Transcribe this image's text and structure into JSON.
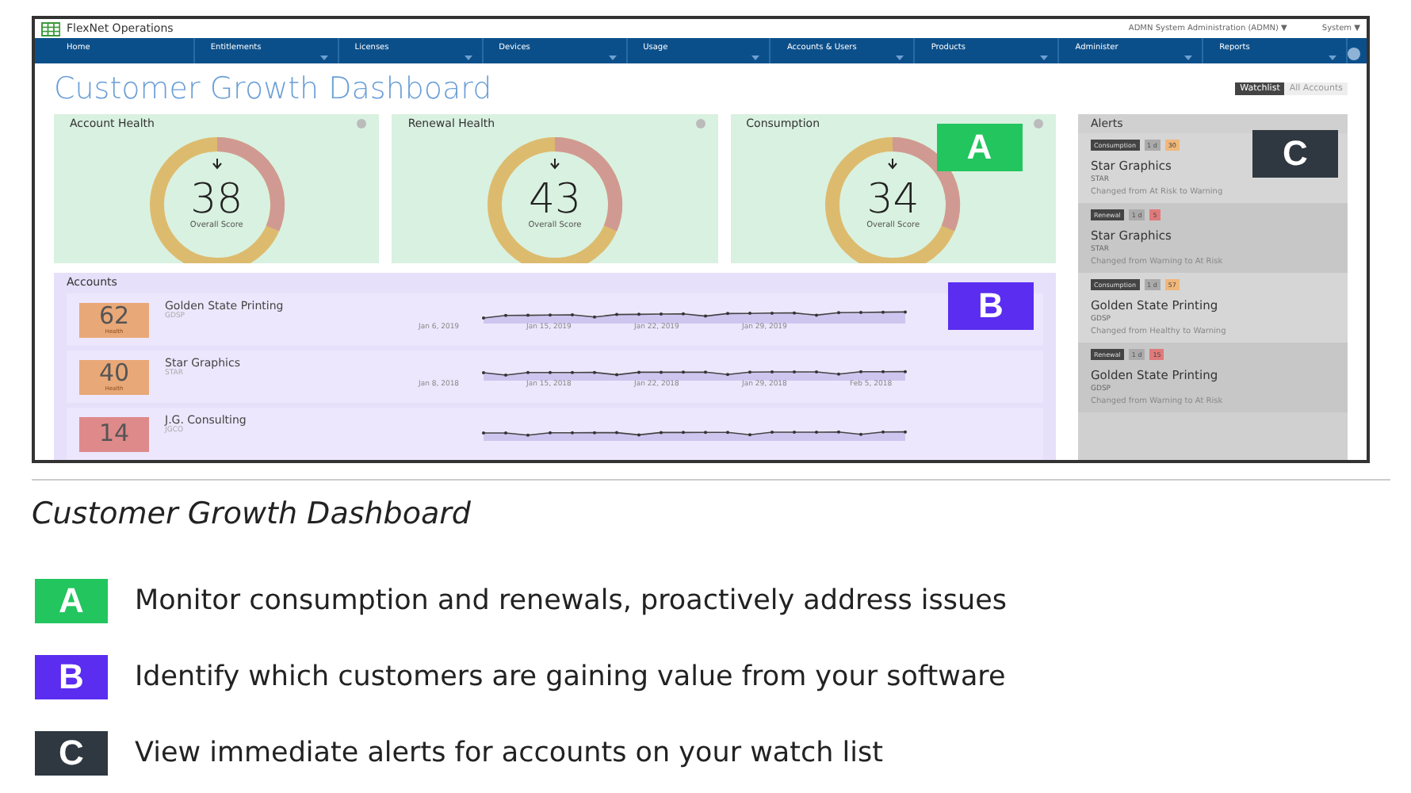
{
  "app": {
    "name": "FlexNet Operations",
    "user_menu": "ADMN System Administration (ADMN) ▼",
    "system_menu": "System ▼"
  },
  "nav": [
    {
      "label": "Home",
      "dropdown": false
    },
    {
      "label": "Entitlements",
      "dropdown": true
    },
    {
      "label": "Licenses",
      "dropdown": true
    },
    {
      "label": "Devices",
      "dropdown": true
    },
    {
      "label": "Usage",
      "dropdown": true
    },
    {
      "label": "Accounts & Users",
      "dropdown": true
    },
    {
      "label": "Products",
      "dropdown": true
    },
    {
      "label": "Administer",
      "dropdown": true
    },
    {
      "label": "Reports",
      "dropdown": true
    }
  ],
  "page_title": "Customer Growth Dashboard",
  "view_tabs": [
    {
      "label": "Watchlist",
      "selected": true
    },
    {
      "label": "All Accounts",
      "selected": false
    }
  ],
  "gauges": [
    {
      "title": "Account Health",
      "score": "38",
      "caption": "Overall Score"
    },
    {
      "title": "Renewal Health",
      "score": "43",
      "caption": "Overall Score"
    },
    {
      "title": "Consumption",
      "score": "34",
      "caption": "Overall Score"
    }
  ],
  "accounts": {
    "title": "Accounts",
    "rows": [
      {
        "health": "62",
        "health_label": "Health",
        "color": "#e9a877",
        "name": "Golden State Printing",
        "code": "GDSP",
        "dates": [
          "Jan 6, 2019",
          "Jan 15, 2019",
          "Jan 22, 2019",
          "Jan 29, 2019"
        ]
      },
      {
        "health": "40",
        "health_label": "Health",
        "color": "#e9a877",
        "name": "Star Graphics",
        "code": "STAR",
        "dates": [
          "Jan 8, 2018",
          "Jan 15, 2018",
          "Jan 22, 2018",
          "Jan 29, 2018",
          "Feb 5, 2018"
        ]
      },
      {
        "health": "14",
        "color": "#de8a8a",
        "name": "J.G. Consulting",
        "code": "JGCO",
        "dates": []
      }
    ]
  },
  "alerts": {
    "title": "Alerts",
    "items": [
      {
        "tag": "Consumption",
        "age": "1 d",
        "count": "30",
        "color": "#f0b77a",
        "name": "Star Graphics",
        "code": "STAR",
        "message": "Changed from At Risk to Warning"
      },
      {
        "tag": "Renewal",
        "age": "1 d",
        "count": "5",
        "color": "#e07a7a",
        "name": "Star Graphics",
        "code": "STAR",
        "message": "Changed from Warning to At Risk"
      },
      {
        "tag": "Consumption",
        "age": "1 d",
        "count": "57",
        "color": "#f0b77a",
        "name": "Golden State Printing",
        "code": "GDSP",
        "message": "Changed from Healthy to Warning"
      },
      {
        "tag": "Renewal",
        "age": "1 d",
        "count": "15",
        "color": "#e07a7a",
        "name": "Golden State Printing",
        "code": "GDSP",
        "message": "Changed from Warning to At Risk"
      }
    ]
  },
  "callouts": [
    {
      "letter": "A",
      "color": "#22c55e"
    },
    {
      "letter": "B",
      "color": "#5a2df0"
    },
    {
      "letter": "C",
      "color": "#2f3841"
    }
  ],
  "caption": "Customer Growth Dashboard",
  "legend": [
    {
      "letter": "A",
      "color": "#22c55e",
      "text": "Monitor consumption and renewals, proactively address issues"
    },
    {
      "letter": "B",
      "color": "#5a2df0",
      "text": "Identify which customers are gaining value from your software"
    },
    {
      "letter": "C",
      "color": "#2f3841",
      "text": "View immediate alerts for accounts on your watch list"
    }
  ]
}
